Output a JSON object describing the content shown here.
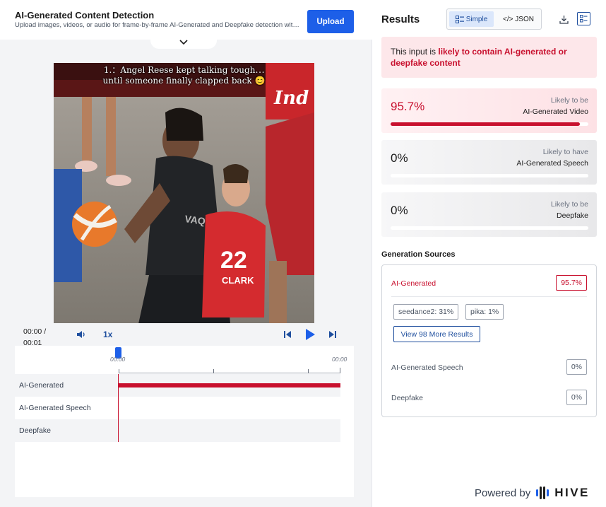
{
  "header": {
    "title": "AI-Generated Content Detection",
    "subtitle": "Upload images, videos, or audio for frame-by-frame AI-Generated and Deepfake detection with…",
    "upload_label": "Upload"
  },
  "video": {
    "caption_line1": "1.：Angel Reese kept talking tough⋯",
    "caption_line2": "until someone finally clapped back 😊",
    "jersey_number": "22",
    "jersey_name": "CLARK"
  },
  "player": {
    "time_current": "00:00 /",
    "time_total": "00:01",
    "speed": "1x",
    "ruler_start": "00:00",
    "ruler_end": "00:00",
    "tracks": [
      {
        "label": "AI-Generated",
        "level": 1
      },
      {
        "label": "AI-Generated Speech",
        "level": 0
      },
      {
        "label": "Deepfake",
        "level": 0
      }
    ]
  },
  "results": {
    "title": "Results",
    "view_simple": "Simple",
    "view_json": "JSON",
    "verdict_prefix": "This input is ",
    "verdict_highlight": "likely to contain AI-generated or deepfake content",
    "cards": [
      {
        "percent": "95.7%",
        "value": 0.957,
        "line1": "Likely to be",
        "line2": "AI-Generated Video"
      },
      {
        "percent": "0%",
        "value": 0,
        "line1": "Likely to have",
        "line2": "AI-Generated Speech"
      },
      {
        "percent": "0%",
        "value": 0,
        "line1": "Likely to be",
        "line2": "Deepfake"
      }
    ]
  },
  "generation_sources": {
    "title": "Generation Sources",
    "ai_generated_label": "AI-Generated",
    "ai_generated_value": "95.7%",
    "chips": [
      "seedance2: 31%",
      "pika: 1%"
    ],
    "more_label": "View 98 More Results",
    "speech_label": "AI-Generated Speech",
    "speech_value": "0%",
    "deepfake_label": "Deepfake",
    "deepfake_value": "0%"
  },
  "footer": {
    "powered_by": "Powered by",
    "brand": "HIVE"
  },
  "colors": {
    "accent_blue": "#1d5fe8",
    "alert_red": "#c8102e"
  }
}
